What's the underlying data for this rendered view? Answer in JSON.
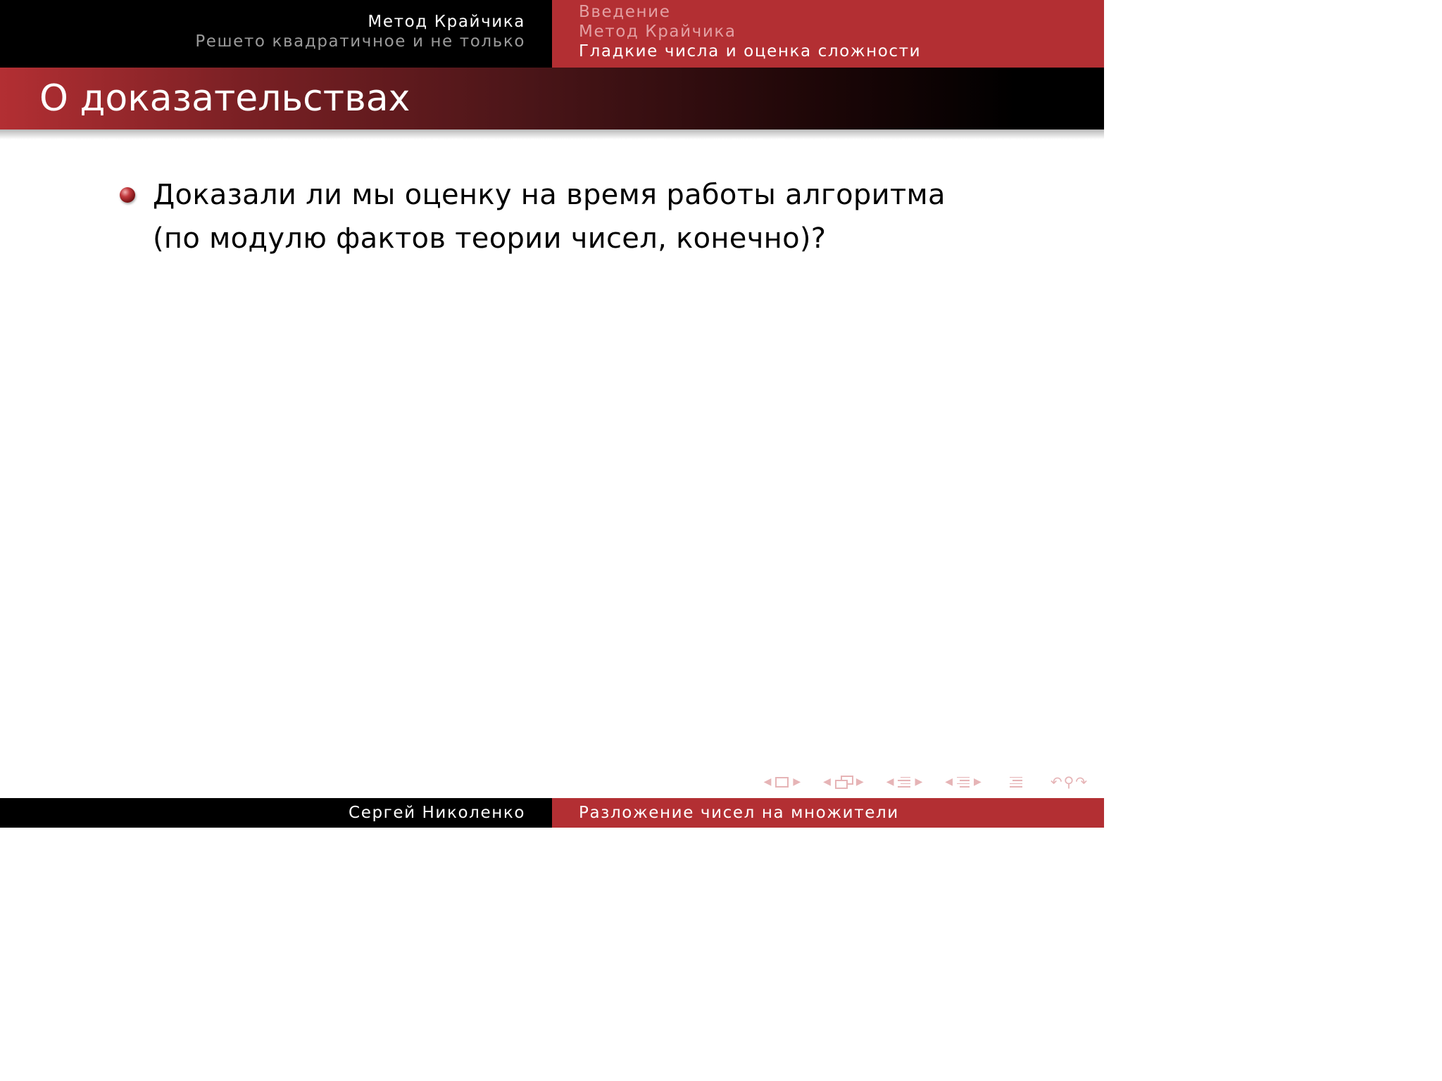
{
  "headline": {
    "left": {
      "section": "Метод Крайчика",
      "subsection": "Решето квадратичное и не только"
    },
    "right": {
      "items": [
        {
          "label": "Введение",
          "state": "inactive"
        },
        {
          "label": "Метод Крайчика",
          "state": "inactive"
        },
        {
          "label": "Гладкие числа и оценка сложности",
          "state": "active"
        }
      ]
    }
  },
  "frame": {
    "title": "О доказательствах",
    "bullets": [
      "Доказали ли мы оценку на время работы алгоритма (по модулю фактов теории чисел, конечно)?"
    ]
  },
  "footline": {
    "author": "Сергей Николенко",
    "talk_title": "Разложение чисел на множители"
  },
  "colors": {
    "accent": "#b32f33",
    "dark": "#000000",
    "inactive_text": "#e3a0a3",
    "subsection_gray": "#9a9a9a",
    "nav_symbols": "#e6b4b6"
  },
  "icons": {
    "bullet": "sphere-bullet-icon",
    "nav": [
      "prev-slide-icon",
      "slide-icon",
      "next-slide-icon",
      "prev-frame-icon",
      "frame-icon",
      "next-frame-icon",
      "prev-subsection-icon",
      "subsection-icon",
      "next-subsection-icon",
      "prev-section-icon",
      "section-icon",
      "next-section-icon",
      "appendix-icon",
      "back-icon",
      "search-icon",
      "forward-icon"
    ]
  }
}
